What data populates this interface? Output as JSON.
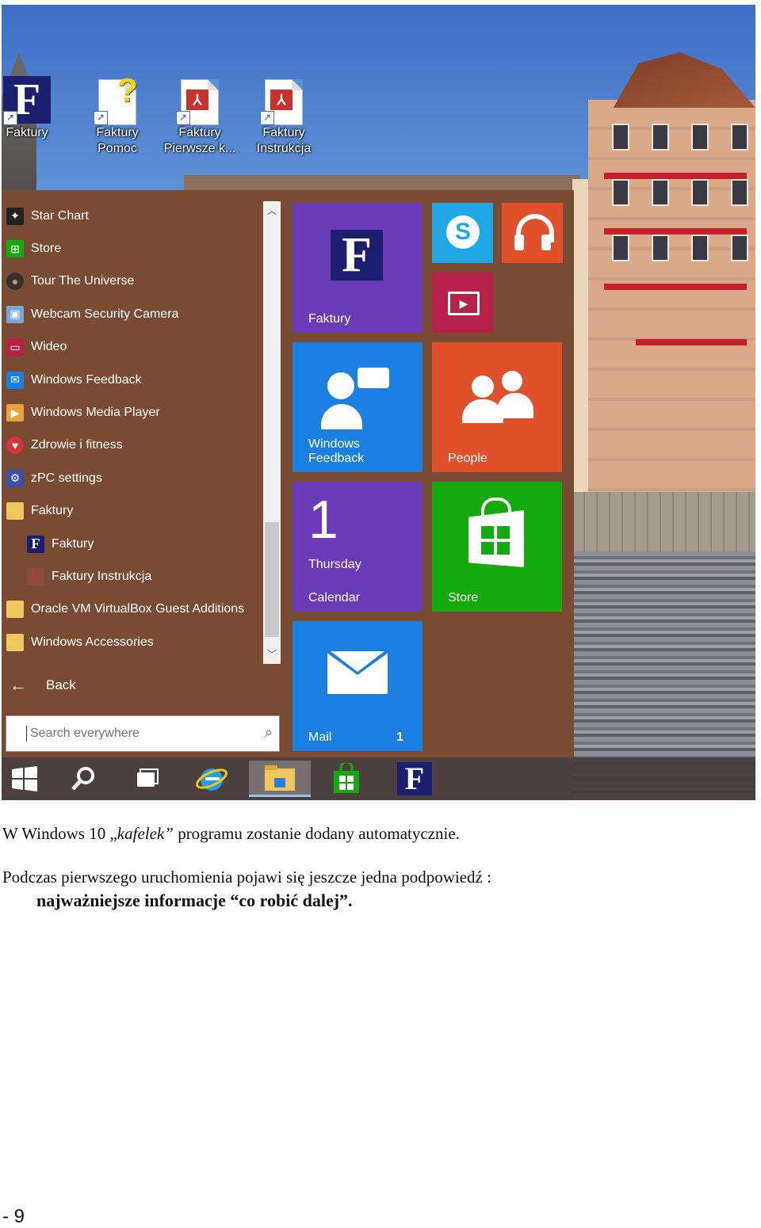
{
  "desktop_icons": [
    {
      "label_line1": "Faktury",
      "label_line2": "",
      "icon": "faktury-logo-icon"
    },
    {
      "label_line1": "Faktury",
      "label_line2": "Pomoc",
      "icon": "help-document-icon"
    },
    {
      "label_line1": "Faktury",
      "label_line2": "Pierwsze k...",
      "icon": "pdf-document-icon"
    },
    {
      "label_line1": "Faktury",
      "label_line2": "Instrukcja",
      "icon": "pdf-document-icon"
    }
  ],
  "start_menu": {
    "apps": [
      {
        "label": "Star Chart",
        "icon": "star-chart-icon"
      },
      {
        "label": "Store",
        "icon": "store-icon"
      },
      {
        "label": "Tour The Universe",
        "icon": "tour-universe-icon"
      },
      {
        "label": "Webcam Security Camera",
        "icon": "webcam-icon"
      },
      {
        "label": "Wideo",
        "icon": "video-icon"
      },
      {
        "label": "Windows Feedback",
        "icon": "feedback-icon"
      },
      {
        "label": "Windows Media Player",
        "icon": "media-player-icon"
      },
      {
        "label": "Zdrowie i fitness",
        "icon": "health-icon"
      },
      {
        "label": "zPC settings",
        "icon": "settings-gear-icon"
      },
      {
        "label": "Faktury",
        "icon": "folder-icon"
      },
      {
        "label": "Faktury",
        "icon": "faktury-logo-icon"
      },
      {
        "label": "Faktury Instrukcja",
        "icon": "pdf-document-icon"
      },
      {
        "label": "Oracle VM VirtualBox Guest Additions",
        "icon": "folder-icon"
      },
      {
        "label": "Windows Accessories",
        "icon": "folder-icon"
      }
    ],
    "back_label": "Back",
    "search_placeholder": "Search everywhere",
    "tiles": {
      "faktury": {
        "label": "Faktury",
        "logo": "F"
      },
      "skype": {
        "icon": "skype-icon"
      },
      "music": {
        "icon": "headphones-icon"
      },
      "video": {
        "icon": "video-play-icon"
      },
      "feedback": {
        "label_line1": "Windows",
        "label_line2": "Feedback"
      },
      "people": {
        "label": "People"
      },
      "calendar": {
        "day_number": "1",
        "day_name": "Thursday",
        "label": "Calendar"
      },
      "store": {
        "label": "Store"
      },
      "mail": {
        "label": "Mail",
        "count": "1"
      }
    },
    "colors": {
      "menu_bg": "#7a4b33",
      "purple": "#6a3bb8",
      "blue": "#1a7fe0",
      "orange": "#e0512b",
      "green": "#14a90c",
      "skype": "#22a7e5",
      "crimson": "#b6214a"
    }
  },
  "taskbar": {
    "items": [
      {
        "icon": "windows-start-icon"
      },
      {
        "icon": "search-icon"
      },
      {
        "icon": "task-view-icon"
      },
      {
        "icon": "internet-explorer-icon"
      },
      {
        "icon": "file-explorer-icon",
        "active": true
      },
      {
        "icon": "store-bag-icon"
      },
      {
        "icon": "faktury-logo-icon"
      }
    ]
  },
  "text": {
    "line1_a": "W Windows 10 „",
    "line1_italic": "kafelek”",
    "line1_b": " programu zostanie dodany automatycznie.",
    "line2": "Podczas pierwszego uruchomienia pojawi się jeszcze jedna podpowiedź :",
    "line3": "najważniejsze informacje “co robić dalej”."
  },
  "page_number": "- 9"
}
